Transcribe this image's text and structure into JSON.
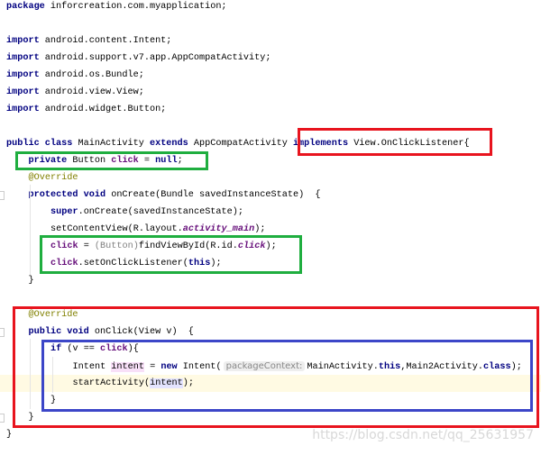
{
  "editor": {
    "current_line": 22,
    "lines": [
      {
        "indent": 0,
        "tokens": [
          {
            "t": "package",
            "c": "kw"
          },
          {
            "t": " inforcreation.com.myapplication;"
          }
        ]
      },
      {
        "indent": 0,
        "tokens": []
      },
      {
        "indent": 0,
        "tokens": [
          {
            "t": "import",
            "c": "kw"
          },
          {
            "t": " android.content.Intent;"
          }
        ]
      },
      {
        "indent": 0,
        "tokens": [
          {
            "t": "import",
            "c": "kw"
          },
          {
            "t": " android.support.v7.app.AppCompatActivity;"
          }
        ]
      },
      {
        "indent": 0,
        "tokens": [
          {
            "t": "import",
            "c": "kw"
          },
          {
            "t": " android.os.Bundle;"
          }
        ]
      },
      {
        "indent": 0,
        "tokens": [
          {
            "t": "import",
            "c": "kw"
          },
          {
            "t": " android.view.View;"
          }
        ]
      },
      {
        "indent": 0,
        "tokens": [
          {
            "t": "import",
            "c": "kw"
          },
          {
            "t": " android.widget.Button;"
          }
        ]
      },
      {
        "indent": 0,
        "tokens": []
      },
      {
        "indent": 0,
        "tokens": [
          {
            "t": "public class",
            "c": "kw"
          },
          {
            "t": " MainActivity "
          },
          {
            "t": "extends",
            "c": "kw"
          },
          {
            "t": " AppCompatActivity "
          },
          {
            "t": "implements",
            "c": "kw"
          },
          {
            "t": " View.OnClickListener{"
          }
        ]
      },
      {
        "indent": 1,
        "tokens": [
          {
            "t": "private",
            "c": "kw"
          },
          {
            "t": " Button "
          },
          {
            "t": "click",
            "c": "fld"
          },
          {
            "t": " = "
          },
          {
            "t": "null",
            "c": "kw"
          },
          {
            "t": ";"
          }
        ]
      },
      {
        "indent": 1,
        "tokens": [
          {
            "t": "@Override",
            "c": "ann"
          }
        ]
      },
      {
        "indent": 1,
        "tokens": [
          {
            "t": "protected void",
            "c": "kw"
          },
          {
            "t": " onCreate(Bundle savedInstanceState)  {"
          }
        ]
      },
      {
        "indent": 2,
        "tokens": [
          {
            "t": "super",
            "c": "kw"
          },
          {
            "t": ".onCreate(savedInstanceState);"
          }
        ]
      },
      {
        "indent": 2,
        "tokens": [
          {
            "t": "setContentView(R.layout."
          },
          {
            "t": "activity_main",
            "c": "st"
          },
          {
            "t": ");"
          }
        ]
      },
      {
        "indent": 2,
        "tokens": [
          {
            "t": "click",
            "c": "fld"
          },
          {
            "t": " = "
          },
          {
            "t": "(Button)",
            "c": "cast"
          },
          {
            "t": "findViewById(R.id."
          },
          {
            "t": "click",
            "c": "st"
          },
          {
            "t": ");"
          }
        ]
      },
      {
        "indent": 2,
        "tokens": [
          {
            "t": "click",
            "c": "fld"
          },
          {
            "t": ".setOnClickListener("
          },
          {
            "t": "this",
            "c": "kw"
          },
          {
            "t": ");"
          }
        ]
      },
      {
        "indent": 1,
        "tokens": [
          {
            "t": "}"
          }
        ]
      },
      {
        "indent": 0,
        "tokens": []
      },
      {
        "indent": 1,
        "tokens": [
          {
            "t": "@Override",
            "c": "ann"
          }
        ]
      },
      {
        "indent": 1,
        "tokens": [
          {
            "t": "public void",
            "c": "kw"
          },
          {
            "t": " onClick(View v)  {"
          }
        ]
      },
      {
        "indent": 2,
        "tokens": [
          {
            "t": "if",
            "c": "kw"
          },
          {
            "t": " (v == "
          },
          {
            "t": "click",
            "c": "fld"
          },
          {
            "t": "){"
          }
        ]
      },
      {
        "indent": 3,
        "tokens": [
          {
            "t": "Intent "
          },
          {
            "t": "intent",
            "c": "hlw"
          },
          {
            "t": " = "
          },
          {
            "t": "new",
            "c": "kw"
          },
          {
            "t": " Intent("
          },
          {
            "t": "packageContext:",
            "c": "hint"
          },
          {
            "t": "MainActivity."
          },
          {
            "t": "this",
            "c": "kw"
          },
          {
            "t": ",Main2Activity."
          },
          {
            "t": "class",
            "c": "kw"
          },
          {
            "t": ");"
          }
        ]
      },
      {
        "indent": 3,
        "tokens": [
          {
            "t": "startActivity("
          },
          {
            "t": "intent",
            "c": "hlr"
          },
          {
            "t": ");"
          }
        ]
      },
      {
        "indent": 2,
        "tokens": [
          {
            "t": "}"
          }
        ]
      },
      {
        "indent": 1,
        "tokens": [
          {
            "t": "}"
          }
        ]
      },
      {
        "indent": 0,
        "tokens": [
          {
            "t": "}"
          }
        ]
      }
    ]
  },
  "annotation_colors": {
    "red": "#e8141e",
    "green": "#1fae3f",
    "blue": "#3c46c8"
  },
  "watermark": "https://blog.csdn.net/qq_25631957"
}
